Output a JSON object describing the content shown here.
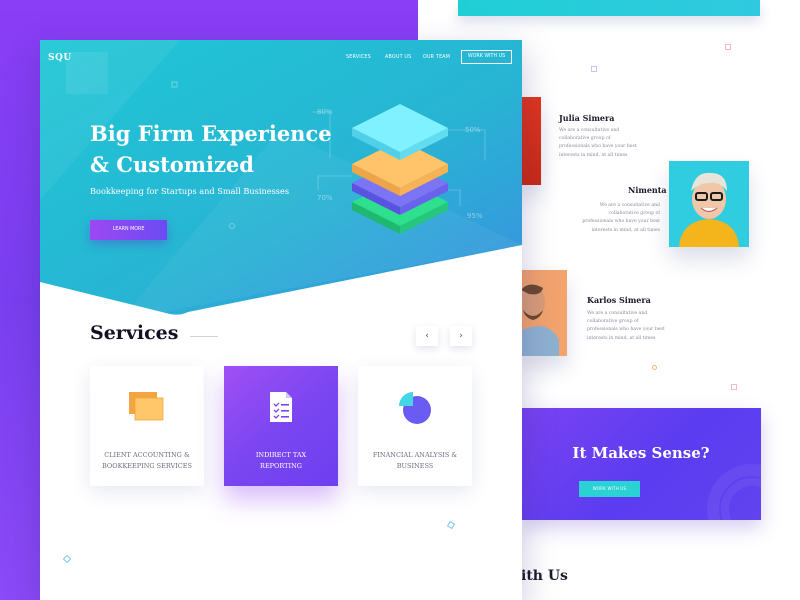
{
  "nav": {
    "logo": "SQU",
    "links": [
      "SERVICES",
      "ABOUT US",
      "OUR TEAM"
    ],
    "cta": "WORK WITH US"
  },
  "hero": {
    "title_line1": "Big Firm Experience",
    "title_line2": "& Customized",
    "subtitle": "Bookkeeping for Startups and Small Businesses",
    "button": "LEARN MORE",
    "stats": [
      "80%",
      "50%",
      "70%",
      "95%"
    ]
  },
  "services": {
    "title": "Services",
    "prev_arrow": "‹",
    "next_arrow": "›",
    "cards": [
      {
        "line1": "CLIENT ACCOUNTING &",
        "line2": "BOOKKEEPING SERVICES",
        "icon": "documents-icon"
      },
      {
        "line1": "INDIRECT TAX",
        "line2": "REPORTING",
        "icon": "checklist-icon"
      },
      {
        "line1": "FINANCIAL ANALYSIS &",
        "line2": "BUSINESS",
        "icon": "pie-chart-icon"
      }
    ]
  },
  "team": {
    "members": [
      {
        "name": "Julia Simera",
        "desc": "We are a consultative and collaborative group of professionals who have your best interests in mind, at all times"
      },
      {
        "name": "Nimenta",
        "desc": "We are a consultative and collaborative group of professionals who have your best interests in mind, at all times"
      },
      {
        "name": "Karlos Simera",
        "desc": "We are a consultative and collaborative group of professionals who have your best interests in mind, at all times"
      }
    ]
  },
  "cta": {
    "title": "It Makes Sense?",
    "button": "WORK WITH US"
  },
  "footer_heading": "ith Us",
  "colors": {
    "purple": "#8a3ef5",
    "teal": "#22c4d6",
    "violet": "#6a43f0",
    "dark_text": "#111122"
  }
}
